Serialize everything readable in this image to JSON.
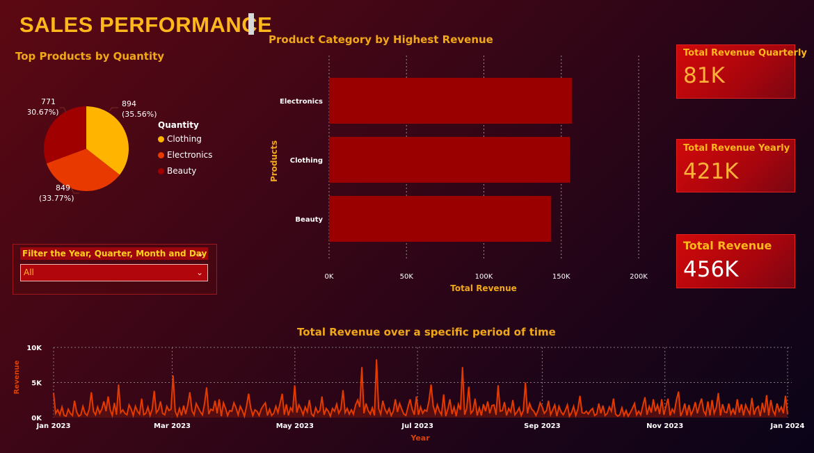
{
  "header": {
    "title": "SALES PERFORMANCE"
  },
  "pie": {
    "title": "Top Products by Quantity",
    "legend_title": "Quantity",
    "labels": [
      {
        "value": "894",
        "pct": "(35.56%)"
      },
      {
        "value": "849",
        "pct": "(33.77%)"
      },
      {
        "value": "771",
        "pct": "(30.67%)"
      }
    ]
  },
  "bar": {
    "title": "Product Category by Highest Revenue",
    "xlabel": "Total Revenue",
    "ylabel": "Products",
    "ticks": [
      "0K",
      "50K",
      "100K",
      "150K",
      "200K"
    ]
  },
  "line": {
    "title": "Total Revenue over a specific period of time",
    "xlabel": "Year",
    "ylabel": "Revenue",
    "yticks": [
      "10K",
      "5K",
      "0K"
    ],
    "xticks": [
      "Jan 2023",
      "Mar 2023",
      "May 2023",
      "Jul 2023",
      "Sep 2023",
      "Nov 2023",
      "Jan 2024"
    ]
  },
  "kpis": {
    "quarterly": {
      "label": "Total Revenue Quarterly",
      "value": "81K"
    },
    "yearly": {
      "label": "Total Revenue Yearly",
      "value": "421K"
    },
    "total": {
      "label": "Total Revenue",
      "value": "456K"
    }
  },
  "filter": {
    "title": "Filter the Year, Quarter, Month and Day",
    "selected": "All"
  },
  "colors": {
    "accent": "#ffb81c",
    "clothing": "#ffb400",
    "electronics": "#e83a00",
    "beauty": "#a00000",
    "bar": "#9b0000",
    "line": "#e33a00"
  },
  "chart_data": [
    {
      "type": "pie",
      "title": "Top Products by Quantity",
      "categories": [
        "Clothing",
        "Electronics",
        "Beauty"
      ],
      "values": [
        894,
        849,
        771
      ],
      "percentages": [
        35.56,
        33.77,
        30.67
      ],
      "legend": "right"
    },
    {
      "type": "bar",
      "orientation": "horizontal",
      "title": "Product Category by Highest Revenue",
      "categories": [
        "Electronics",
        "Clothing",
        "Beauty"
      ],
      "values": [
        157000,
        155500,
        143500
      ],
      "xlabel": "Total Revenue",
      "ylabel": "Products",
      "xlim": [
        0,
        200000
      ],
      "grid": true
    },
    {
      "type": "area",
      "title": "Total Revenue over a specific period of time",
      "xlabel": "Year",
      "ylabel": "Revenue",
      "ylim": [
        0,
        10000
      ],
      "xlim": [
        "2023-01-01",
        "2024-01-01"
      ],
      "x_start": "2023-01-01",
      "x_step": "1 day",
      "values": [
        3500,
        600,
        1100,
        400,
        1500,
        300,
        200,
        1200,
        600,
        300,
        2400,
        800,
        200,
        400,
        1600,
        600,
        300,
        1200,
        3600,
        900,
        400,
        1500,
        600,
        1200,
        2300,
        900,
        3000,
        1100,
        300,
        2100,
        400,
        4700,
        700,
        1100,
        600,
        400,
        1800,
        1200,
        300,
        1600,
        900,
        500,
        2700,
        400,
        600,
        1500,
        300,
        1200,
        3800,
        700,
        1100,
        2300,
        600,
        400,
        1600,
        1000,
        1200,
        6000,
        900,
        200,
        1300,
        300,
        1700,
        500,
        1800,
        3600,
        1000,
        400,
        2000,
        1400,
        800,
        400,
        2000,
        4300,
        500,
        1200,
        1000,
        2400,
        600,
        2600,
        200,
        2100,
        1300,
        300,
        1000,
        900,
        2100,
        1400,
        400,
        1600,
        1000,
        200,
        1600,
        3400,
        1400,
        300,
        1100,
        900,
        300,
        1200,
        1700,
        2100,
        300,
        1200,
        300,
        600,
        1600,
        700,
        2000,
        3400,
        400,
        1900,
        300,
        1400,
        900,
        4600,
        700,
        1800,
        1200,
        400,
        1500,
        800,
        2500,
        500,
        200,
        1400,
        700,
        1000,
        3000,
        400,
        1300,
        900,
        200,
        1300,
        900,
        1900,
        600,
        1200,
        3900,
        700,
        1300,
        500,
        1100,
        500,
        1800,
        2500,
        1500,
        7200,
        600,
        2000,
        1000,
        500,
        1400,
        300,
        8300,
        1300,
        500,
        2400,
        1200,
        600,
        1300,
        300,
        900,
        2600,
        800,
        2000,
        1200,
        500,
        300,
        1500,
        2600,
        1200,
        400,
        3000,
        400,
        1500,
        600,
        1100,
        900,
        2400,
        4700,
        1700,
        600,
        1800,
        900,
        400,
        3300,
        200,
        1200,
        2600,
        500,
        1500,
        200,
        1900,
        1100,
        7200,
        400,
        1300,
        4400,
        600,
        1000,
        2700,
        300,
        1400,
        300,
        1900,
        900,
        2300,
        600,
        1700,
        1800,
        400,
        4600,
        900,
        1000,
        2200,
        300,
        1300,
        800,
        2500,
        400,
        800,
        1400,
        300,
        1000,
        5000,
        600,
        2000,
        1200,
        900,
        300,
        1000,
        2100,
        1500,
        600,
        1000,
        2400,
        400,
        1100,
        1800,
        200,
        1600,
        800,
        400,
        1000,
        1800,
        200,
        700,
        1600,
        300,
        1200,
        3100,
        700,
        600,
        900,
        500,
        1000,
        1300,
        300,
        500,
        2000,
        600,
        1700,
        300,
        600,
        1500,
        900,
        2700,
        500,
        200,
        400,
        1400,
        300,
        1000,
        200,
        700,
        1300,
        2000,
        400,
        900,
        400,
        1700,
        2900,
        400,
        1600,
        700,
        2600,
        900,
        1800,
        500,
        2600,
        400,
        1600,
        2700,
        300,
        1200,
        700,
        2500,
        3700,
        200,
        900,
        2000,
        300,
        1800,
        400,
        1100,
        2200,
        600,
        1800,
        2700,
        900,
        400,
        2300,
        300,
        2500,
        600,
        1400,
        3500,
        300,
        1900,
        800,
        700,
        2000,
        500,
        1200,
        400,
        2600,
        700,
        1900,
        300,
        1800,
        1100,
        500,
        2800,
        400,
        1300,
        1600,
        200,
        2100,
        700,
        3200,
        300,
        2500,
        1000,
        400,
        2000,
        900,
        1500,
        600,
        3100,
        500
      ]
    }
  ]
}
